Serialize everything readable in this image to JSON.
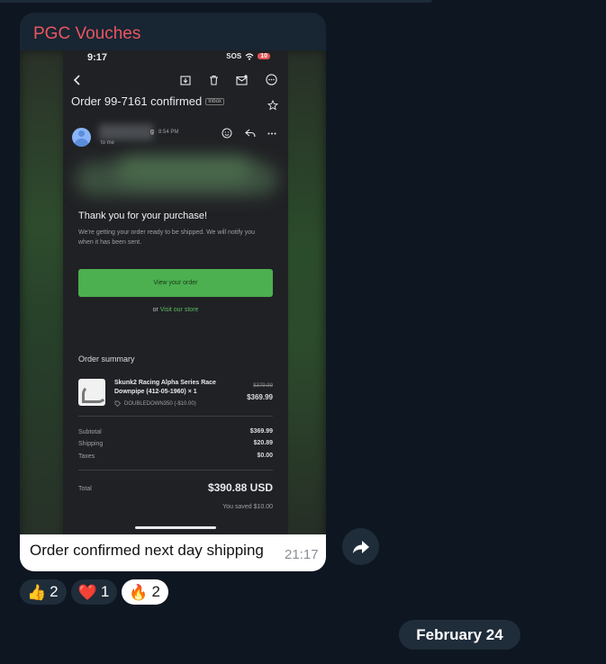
{
  "channel": {
    "name": "PGC Vouches",
    "name_color": "#e9565f"
  },
  "email": {
    "status_time": "9:17",
    "status_sos": "SOS",
    "battery": "10",
    "subject": "Order 99-7161 confirmed",
    "inbox_tag": "Inbox",
    "sender_initial": "g",
    "sender_time": "8:54 PM",
    "to": "to me",
    "thanks_title": "Thank you for your purchase!",
    "thanks_body": "We're getting your order ready to be shipped. We will notify you when it has been sent.",
    "view_button": "View your order",
    "or_text": "or",
    "store_link": "Visit our store",
    "summary_title": "Order summary",
    "product_name": "Skunk2 Racing Alpha Series Race Downpipe (412-05-1960) × 1",
    "discount_code": "DOUBLEDOWN350 (-$10.00)",
    "original_price": "$379.99",
    "price": "$369.99",
    "subtotal_label": "Subtotal",
    "subtotal_value": "$369.99",
    "shipping_label": "Shipping",
    "shipping_value": "$20.89",
    "taxes_label": "Taxes",
    "taxes_value": "$0.00",
    "total_label": "Total",
    "total_value": "$390.88 USD",
    "saved_text": "You saved $10.00",
    "button_color": "#4caf50"
  },
  "message": {
    "caption": "Order confirmed next day shipping",
    "time": "21:17"
  },
  "reactions": [
    {
      "emoji": "👍",
      "count": "2"
    },
    {
      "emoji": "❤️",
      "count": "1"
    },
    {
      "emoji": "🔥",
      "count": "2"
    }
  ],
  "date_separator": "February 24"
}
